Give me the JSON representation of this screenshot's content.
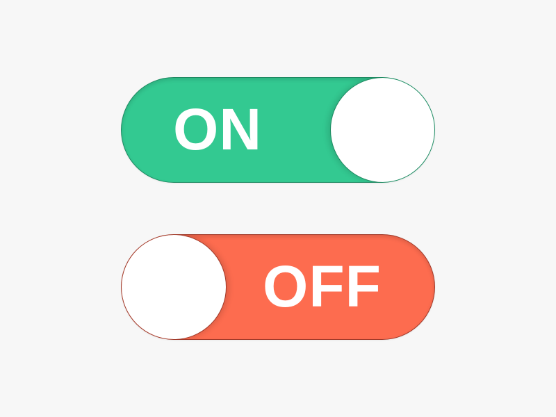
{
  "toggles": [
    {
      "label": "ON",
      "state": "on",
      "track_color": "#33c991",
      "border_color": "#1f8a62",
      "knob_color": "#ffffff"
    },
    {
      "label": "OFF",
      "state": "off",
      "track_color": "#fd6c4f",
      "border_color": "#a13a2a",
      "knob_color": "#ffffff"
    }
  ],
  "background_color": "#f7f7f7"
}
